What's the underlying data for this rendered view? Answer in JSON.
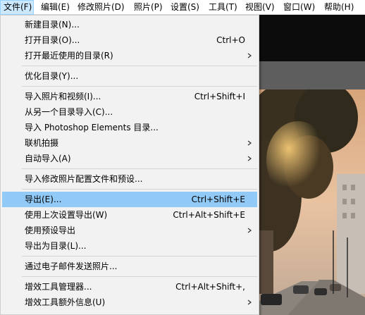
{
  "menubar": {
    "items": [
      {
        "label": "文件(F)"
      },
      {
        "label": "编辑(E)"
      },
      {
        "label": "修改照片(D)"
      },
      {
        "label": "照片(P)"
      },
      {
        "label": "设置(S)"
      },
      {
        "label": "工具(T)"
      },
      {
        "label": "视图(V)"
      },
      {
        "label": "窗口(W)"
      },
      {
        "label": "帮助(H)"
      }
    ],
    "active_index": 0
  },
  "file_menu": {
    "items": [
      {
        "label": "新建目录(N)...",
        "shortcut": ""
      },
      {
        "label": "打开目录(O)...",
        "shortcut": "Ctrl+O"
      },
      {
        "label": "打开最近使用的目录(R)",
        "shortcut": "",
        "submenu": true
      },
      {
        "label": "优化目录(Y)...",
        "shortcut": ""
      },
      {
        "label": "导入照片和视频(I)...",
        "shortcut": "Ctrl+Shift+I"
      },
      {
        "label": "从另一个目录导入(C)...",
        "shortcut": ""
      },
      {
        "label": "导入 Photoshop Elements 目录...",
        "shortcut": ""
      },
      {
        "label": "联机拍摄",
        "shortcut": "",
        "submenu": true
      },
      {
        "label": "自动导入(A)",
        "shortcut": "",
        "submenu": true
      },
      {
        "label": "导入修改照片配置文件和预设...",
        "shortcut": ""
      },
      {
        "label": "导出(E)...",
        "shortcut": "Ctrl+Shift+E",
        "highlighted": true
      },
      {
        "label": "使用上次设置导出(W)",
        "shortcut": "Ctrl+Alt+Shift+E"
      },
      {
        "label": "使用预设导出",
        "shortcut": "",
        "submenu": true
      },
      {
        "label": "导出为目录(L)...",
        "shortcut": ""
      },
      {
        "label": "通过电子邮件发送照片...",
        "shortcut": ""
      },
      {
        "label": "增效工具管理器...",
        "shortcut": "Ctrl+Alt+Shift+,"
      },
      {
        "label": "增效工具额外信息(U)",
        "shortcut": "",
        "submenu": true
      }
    ]
  },
  "colors": {
    "highlight": "#91c9f7",
    "menubar_active": "#cce8ff",
    "menu_background": "#f2f2f2"
  },
  "icons": {
    "submenu": "chevron-right-icon"
  }
}
